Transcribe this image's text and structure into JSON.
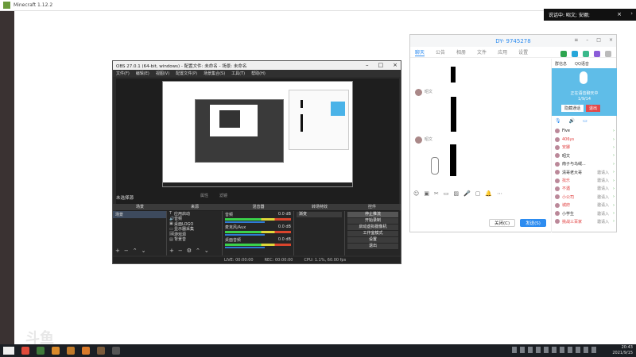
{
  "minecraft": {
    "title": "Minecraft 1.12.2"
  },
  "notification": {
    "text": "说话中: 昭文; 安娜;"
  },
  "obs": {
    "title": "OBS 27.0.1 (64-bit, windows) - 配置文件: 未命名 - 场景: 未命名",
    "menu": [
      "文件(F)",
      "编辑(E)",
      "视图(V)",
      "配置文件(P)",
      "场景集合(S)",
      "工具(T)",
      "帮助(H)"
    ],
    "no_source": "未选择源",
    "mid_buttons": [
      "属性",
      "滤镜"
    ],
    "dock_titles": {
      "scenes": "场景",
      "sources": "来源",
      "mixer": "混音器",
      "transitions": "转场特效",
      "controls": "控件"
    },
    "scenes": [
      "场景"
    ],
    "sources": [
      {
        "icon": "T",
        "name": "应用启动"
      },
      {
        "icon": "🔊",
        "name": "音频"
      },
      {
        "icon": "▣",
        "name": "桌面LOGO"
      },
      {
        "icon": "▭",
        "name": "显示器采集"
      },
      {
        "icon": "🖼",
        "name": "游戏源"
      },
      {
        "icon": "▤",
        "name": "背景音"
      }
    ],
    "mixer": [
      {
        "name": "音频",
        "db": "0.0 dB"
      },
      {
        "name": "麦克风/Aux",
        "db": "0.0 dB"
      },
      {
        "name": "桌面音频",
        "db": "0.0 dB"
      }
    ],
    "transition": "渐变",
    "controls": [
      "停止推流",
      "开始录制",
      "启动虚拟摄像机",
      "工作室模式",
      "设置",
      "退出"
    ],
    "status": [
      "LIVE: 00:00:00",
      "REC: 00:00:00",
      "CPU: 1.1%, 60.00 fps"
    ]
  },
  "qq": {
    "title": "DY- 9745278",
    "tabs": [
      "聊天",
      "公告",
      "相册",
      "文件",
      "应用",
      "设置"
    ],
    "sender": "昭文",
    "side_tabs": [
      "群信息",
      "QQ语音"
    ],
    "voice_status": "正在语音聊天中",
    "voice_count": "1/9/14",
    "voice_buttons": [
      "隐藏通话",
      "退出"
    ],
    "members": [
      {
        "name": "Five",
        "status": "",
        "color": "#222"
      },
      {
        "name": "406ys",
        "status": "",
        "color": "#e03c3c"
      },
      {
        "name": "安娜",
        "status": "",
        "color": "#e03c3c"
      },
      {
        "name": "昭文",
        "status": "",
        "color": "#222"
      },
      {
        "name": "南子与乌绒...",
        "status": "",
        "color": "#222"
      },
      {
        "name": "清哥老大哥",
        "status": "邀请入",
        "color": "#222"
      },
      {
        "name": "找乐",
        "status": "邀请入",
        "color": "#e03c3c"
      },
      {
        "name": "不遇",
        "status": "邀请入",
        "color": "#e03c3c"
      },
      {
        "name": "小公司",
        "status": "邀请入",
        "color": "#e03c3c"
      },
      {
        "name": "城府",
        "status": "邀请入",
        "color": "#e03c3c"
      },
      {
        "name": "小学生",
        "status": "邀请入",
        "color": "#222"
      },
      {
        "name": "挑战三百家",
        "status": "邀请入",
        "color": "#e03c3c"
      }
    ],
    "close_btn": "关闭(C)",
    "send_btn": "发送(S)"
  },
  "taskbar": {
    "time": "20:43",
    "date": "2021/9/15"
  },
  "watermark": "斗鱼"
}
